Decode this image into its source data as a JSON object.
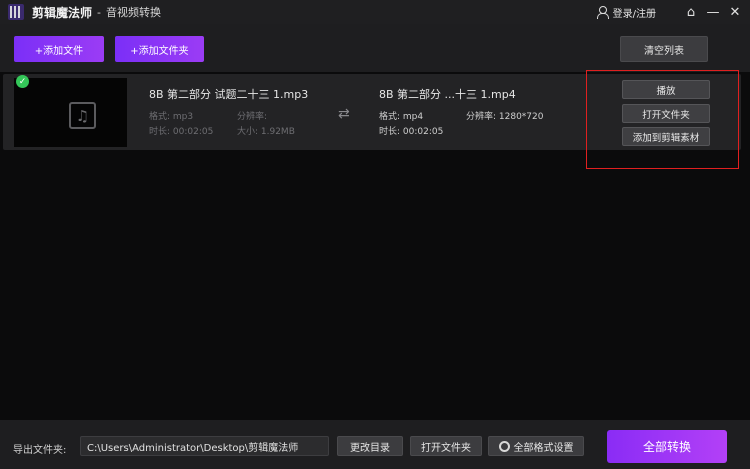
{
  "titlebar": {
    "app_name": "剪辑魔法师",
    "separator": "-",
    "subtitle": "音视频转换",
    "login": "登录/注册",
    "home_glyph": "⌂",
    "min_glyph": "—",
    "close_glyph": "✕"
  },
  "toolbar": {
    "add_file": "+添加文件",
    "add_folder": "+添加文件夹",
    "clear_list": "清空列表"
  },
  "file_item": {
    "checked": true,
    "source": {
      "name": "8B 第二部分 试题二十三 1.mp3",
      "format": "格式: mp3",
      "resolution": "分辨率:",
      "duration": "时长: 00:02:05",
      "size": "大小: 1.92MB"
    },
    "output": {
      "name": "8B 第二部分 ...十三 1.mp4",
      "format": "格式: mp4",
      "resolution": "分辨率: 1280*720",
      "duration": "时长: 00:02:05"
    },
    "actions": {
      "play": "播放",
      "open_folder": "打开文件夹",
      "add_to_material": "添加到剪辑素材"
    },
    "highlight_color": "#e02020"
  },
  "footer": {
    "output_label": "导出文件夹:",
    "output_path": "C:\\Users\\Administrator\\Desktop\\剪辑魔法师",
    "change_dir": "更改目录",
    "open_folder": "打开文件夹",
    "format_settings": "全部格式设置",
    "convert_all": "全部转换"
  },
  "colors": {
    "accent": "#8a2cf5",
    "success": "#34c759"
  }
}
